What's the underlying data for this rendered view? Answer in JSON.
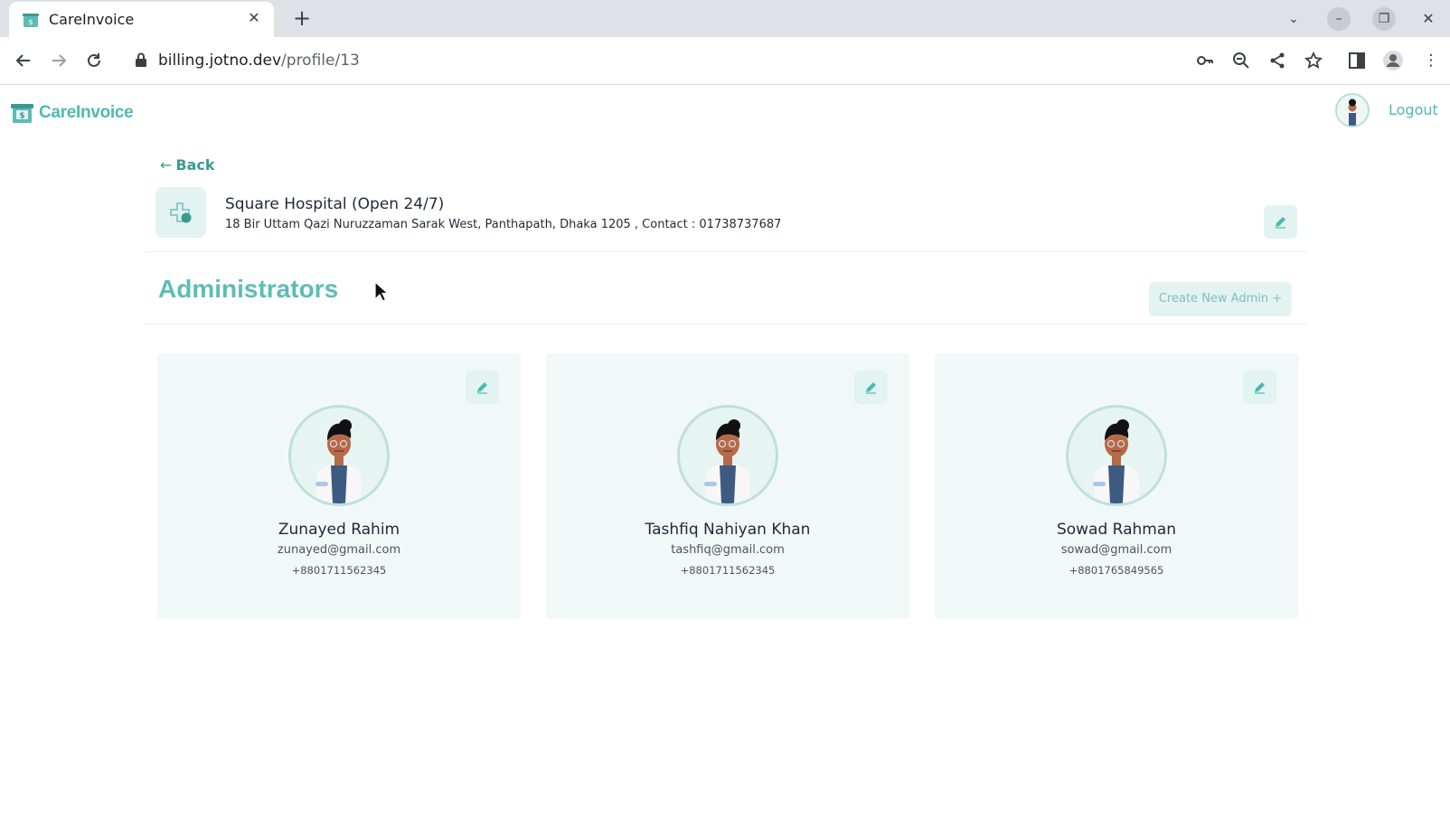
{
  "browser": {
    "tab_title": "CareInvoice",
    "url_host": "billing.jotno.dev",
    "url_path": "/profile/13"
  },
  "navbar": {
    "brand": "CareInvoice",
    "logout_label": "Logout"
  },
  "hospital": {
    "back_label": "Back",
    "name": "Square Hospital (Open 24/7)",
    "address": "18 Bir Uttam Qazi Nuruzzaman Sarak West, Panthapath, Dhaka 1205 , Contact : 01738737687"
  },
  "admins_section": {
    "title": "Administrators",
    "create_button": "Create New Admin +"
  },
  "admins": [
    {
      "name": "Zunayed Rahim",
      "email": "zunayed@gmail.com",
      "phone": "+8801711562345"
    },
    {
      "name": "Tashfiq Nahiyan Khan",
      "email": "tashfiq@gmail.com",
      "phone": "+8801711562345"
    },
    {
      "name": "Sowad Rahman",
      "email": "sowad@gmail.com",
      "phone": "+8801765849565"
    }
  ],
  "colors": {
    "accent": "#4fb9b1",
    "accent_light": "#e3f3f1",
    "card_bg": "#f1f9f8"
  },
  "icons": {
    "favicon": "invoice-register-icon",
    "hospital": "hospital-plus-icon",
    "edit": "pencil-icon",
    "avatar": "doctor-avatar-icon"
  }
}
